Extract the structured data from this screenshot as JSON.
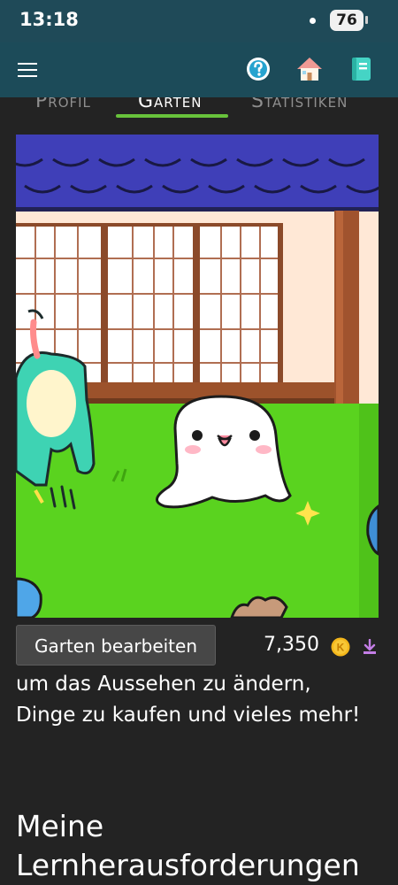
{
  "status": {
    "time": "13:18",
    "battery": "76"
  },
  "appbar": {
    "menu_icon": "hamburger-menu-icon",
    "help_icon": "help-icon",
    "home_icon": "home-icon",
    "book_icon": "book-icon"
  },
  "tabs": [
    {
      "label": "Profil",
      "active": false
    },
    {
      "label": "Garten",
      "active": true
    },
    {
      "label": "Statistiken",
      "active": false
    }
  ],
  "garden": {
    "edit_button": "Garten bearbeiten",
    "coins": "7,350",
    "coin_letter": "K"
  },
  "description": "um das Aussehen zu ändern, Dinge zu kaufen und vieles mehr!",
  "section_title": "Meine Lernherausforderungen",
  "colors": {
    "statusbar": "#1f4a58",
    "appbar": "#1c4b59",
    "accent": "#68c23b",
    "background": "#232323",
    "grass": "#5ad31f"
  }
}
